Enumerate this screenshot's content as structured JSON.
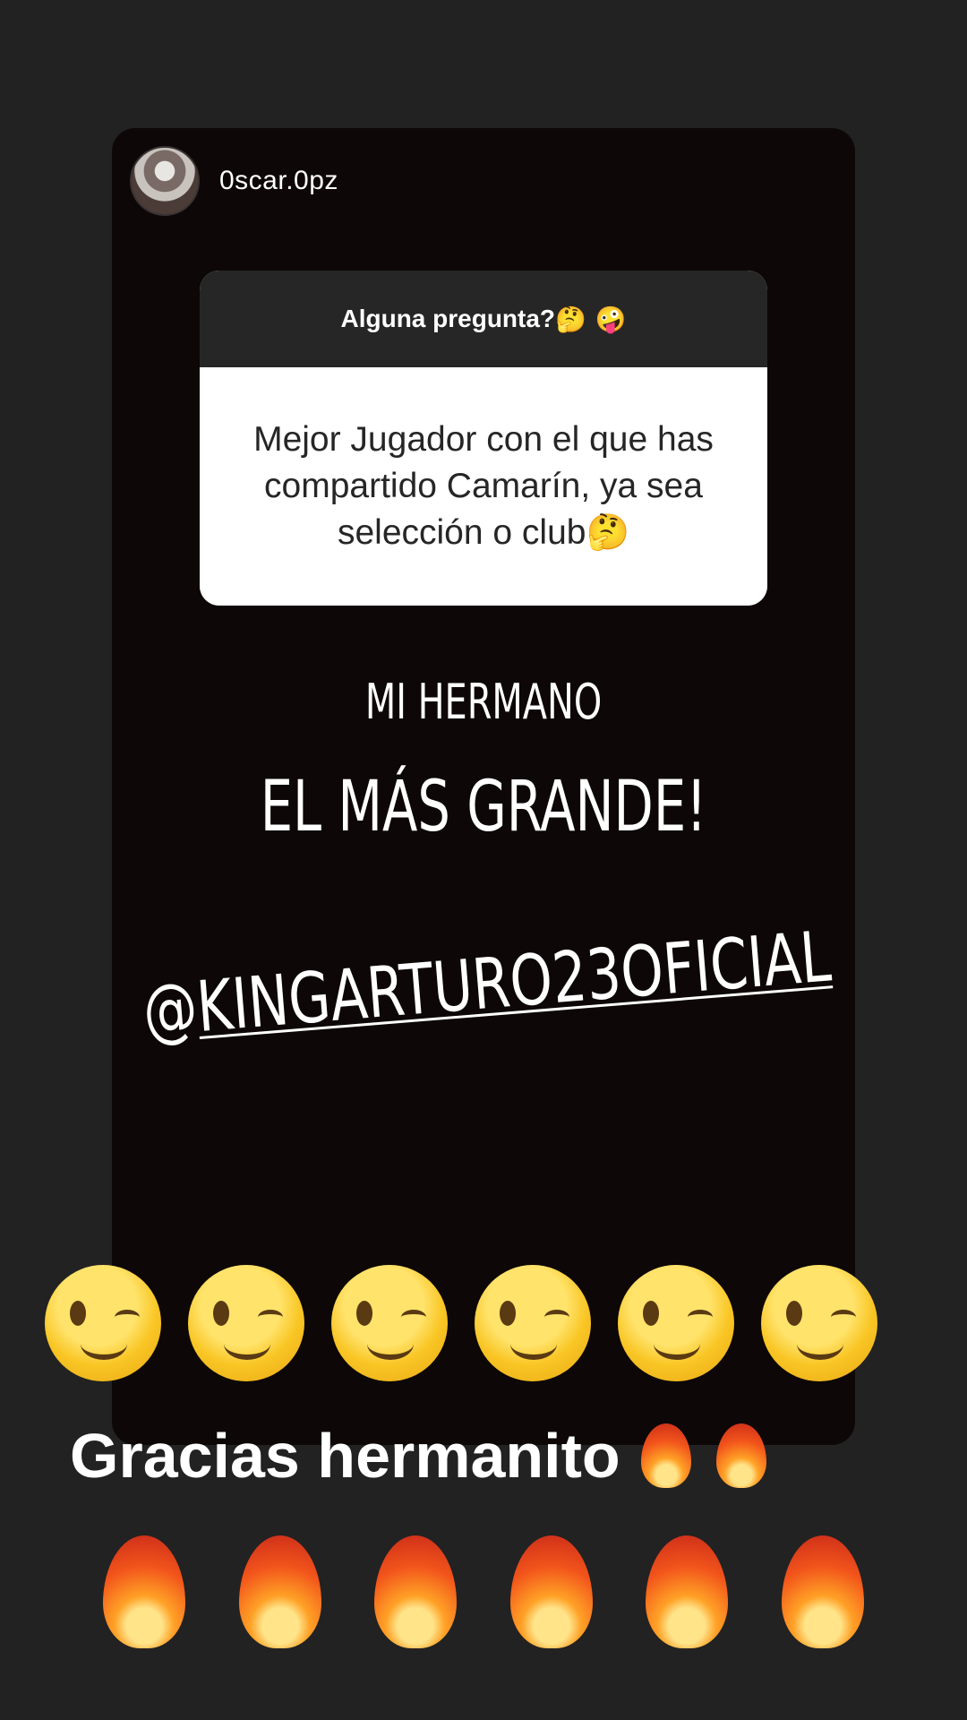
{
  "story": {
    "username": "0scar.0pz",
    "question_box": {
      "title": "Alguna pregunta?",
      "title_emojis": "🤔 🤪",
      "question": "Mejor Jugador con el que has compartido Camarín, ya sea selección o club",
      "question_emoji": "🤔"
    },
    "line1": "MI HERMANO",
    "line2": "EL MÁS GRANDE!",
    "mention_at": "@",
    "mention_name": "KINGARTURO23OFICIAL"
  },
  "overlay": {
    "wink_emojis": [
      "😉",
      "😉",
      "😉",
      "😉",
      "😉",
      "😉"
    ],
    "thanks_text": "Gracias hermanito",
    "thanks_emojis": [
      "🔥",
      "🔥"
    ],
    "fire_emojis": [
      "🔥",
      "🔥",
      "🔥",
      "🔥",
      "🔥",
      "🔥"
    ]
  },
  "colors": {
    "background": "#222222",
    "card": "#0d0707",
    "question_header": "#262626"
  }
}
